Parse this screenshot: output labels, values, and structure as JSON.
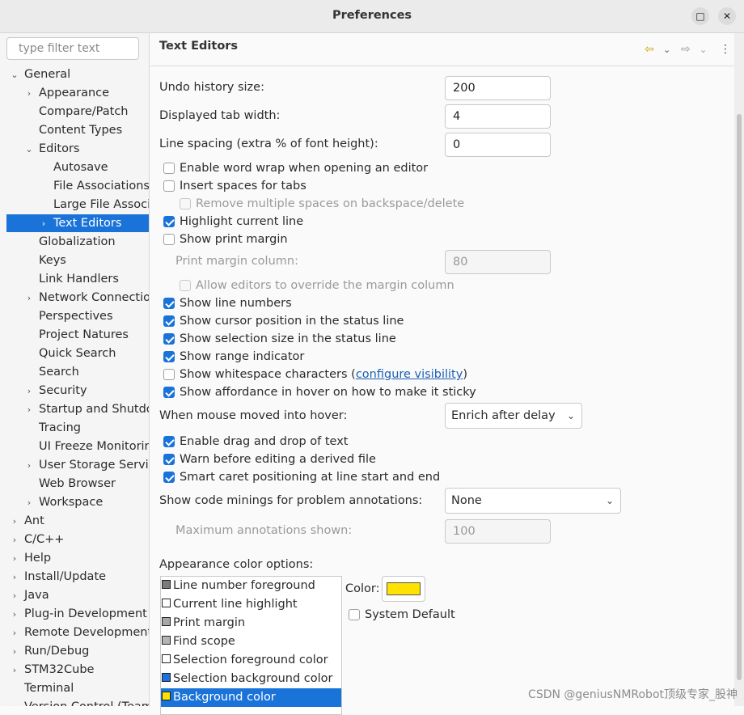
{
  "window": {
    "title": "Preferences",
    "minimize_glyph": "□",
    "close_glyph": "✕"
  },
  "sidebar": {
    "filter_placeholder": "type filter text",
    "items": [
      {
        "label": "General",
        "indent": 0,
        "arrow": "⌄"
      },
      {
        "label": "Appearance",
        "indent": 1,
        "arrow": "›"
      },
      {
        "label": "Compare/Patch",
        "indent": 1,
        "arrow": ""
      },
      {
        "label": "Content Types",
        "indent": 1,
        "arrow": ""
      },
      {
        "label": "Editors",
        "indent": 1,
        "arrow": "⌄"
      },
      {
        "label": "Autosave",
        "indent": 2,
        "arrow": ""
      },
      {
        "label": "File Associations",
        "indent": 2,
        "arrow": ""
      },
      {
        "label": "Large File Associations",
        "indent": 2,
        "arrow": ""
      },
      {
        "label": "Text Editors",
        "indent": 2,
        "arrow": "›",
        "selected": true
      },
      {
        "label": "Globalization",
        "indent": 1,
        "arrow": ""
      },
      {
        "label": "Keys",
        "indent": 1,
        "arrow": ""
      },
      {
        "label": "Link Handlers",
        "indent": 1,
        "arrow": ""
      },
      {
        "label": "Network Connections",
        "indent": 1,
        "arrow": "›"
      },
      {
        "label": "Perspectives",
        "indent": 1,
        "arrow": ""
      },
      {
        "label": "Project Natures",
        "indent": 1,
        "arrow": ""
      },
      {
        "label": "Quick Search",
        "indent": 1,
        "arrow": ""
      },
      {
        "label": "Search",
        "indent": 1,
        "arrow": ""
      },
      {
        "label": "Security",
        "indent": 1,
        "arrow": "›"
      },
      {
        "label": "Startup and Shutdown",
        "indent": 1,
        "arrow": "›"
      },
      {
        "label": "Tracing",
        "indent": 1,
        "arrow": ""
      },
      {
        "label": "UI Freeze Monitoring",
        "indent": 1,
        "arrow": ""
      },
      {
        "label": "User Storage Service",
        "indent": 1,
        "arrow": "›"
      },
      {
        "label": "Web Browser",
        "indent": 1,
        "arrow": ""
      },
      {
        "label": "Workspace",
        "indent": 1,
        "arrow": "›"
      },
      {
        "label": "Ant",
        "indent": 0,
        "arrow": "›"
      },
      {
        "label": "C/C++",
        "indent": 0,
        "arrow": "›"
      },
      {
        "label": "Help",
        "indent": 0,
        "arrow": "›"
      },
      {
        "label": "Install/Update",
        "indent": 0,
        "arrow": "›"
      },
      {
        "label": "Java",
        "indent": 0,
        "arrow": "›"
      },
      {
        "label": "Plug-in Development",
        "indent": 0,
        "arrow": "›"
      },
      {
        "label": "Remote Development",
        "indent": 0,
        "arrow": "›"
      },
      {
        "label": "Run/Debug",
        "indent": 0,
        "arrow": "›"
      },
      {
        "label": "STM32Cube",
        "indent": 0,
        "arrow": "›"
      },
      {
        "label": "Terminal",
        "indent": 0,
        "arrow": ""
      },
      {
        "label": "Version Control (Team)",
        "indent": 0,
        "arrow": "›"
      }
    ]
  },
  "page": {
    "title": "Text Editors",
    "nav": {
      "back": "⇦",
      "forward": "⇨",
      "dropdown": "⌄",
      "menu": "⋮"
    },
    "undo_label": "Undo history size:",
    "undo_value": "200",
    "tab_label": "Displayed tab width:",
    "tab_value": "4",
    "spacing_label": "Line spacing (extra % of font height):",
    "spacing_value": "0",
    "cb_wrap": "Enable word wrap when opening an editor",
    "cb_spaces": "Insert spaces for tabs",
    "cb_remove_spaces": "Remove multiple spaces on backspace/delete",
    "cb_highlight": "Highlight current line",
    "cb_print_margin": "Show print margin",
    "print_margin_label": "Print margin column:",
    "print_margin_value": "80",
    "cb_override_margin": "Allow editors to override the margin column",
    "cb_line_numbers": "Show line numbers",
    "cb_cursor": "Show cursor position in the status line",
    "cb_selection": "Show selection size in the status line",
    "cb_range": "Show range indicator",
    "cb_whitespace": "Show whitespace characters (",
    "whitespace_link": "configure visibility",
    "whitespace_close": ")",
    "cb_affordance": "Show affordance in hover on how to make it sticky",
    "hover_label": "When mouse moved into hover:",
    "hover_value": "Enrich after delay",
    "cb_dnd": "Enable drag and drop of text",
    "cb_warn": "Warn before editing a derived file",
    "cb_caret": "Smart caret positioning at line start and end",
    "minings_label": "Show code minings for problem annotations:",
    "minings_value": "None",
    "max_annotations_label": "Maximum annotations shown:",
    "max_annotations_value": "100",
    "appearance_label": "Appearance color options:",
    "color_label": "Color:",
    "system_default": "System Default",
    "selected_color": "#ffe200",
    "color_options": [
      {
        "label": "Line number foreground",
        "swatch": "#7a7a7a"
      },
      {
        "label": "Current line highlight",
        "swatch": "#ffffff"
      },
      {
        "label": "Print margin",
        "swatch": "#a8a8a8"
      },
      {
        "label": "Find scope",
        "swatch": "#b4b4b4"
      },
      {
        "label": "Selection foreground color",
        "swatch": "#ffffff"
      },
      {
        "label": "Selection background color",
        "swatch": "#1a73d8"
      },
      {
        "label": "Background color",
        "swatch": "#ffe200",
        "selected": true
      }
    ]
  },
  "watermark": "CSDN @geniusNMRobot顶级专家_股神"
}
